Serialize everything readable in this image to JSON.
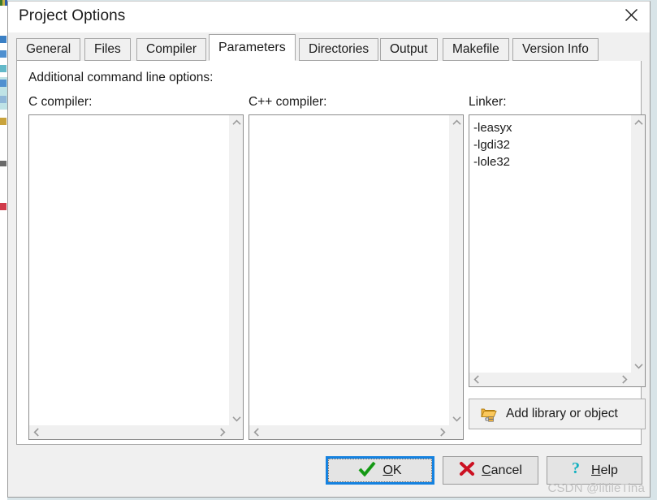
{
  "window": {
    "title": "Project Options",
    "close_label": "×"
  },
  "tabs": [
    {
      "label": "General",
      "active": false
    },
    {
      "label": "Files",
      "active": false
    },
    {
      "label": "Compiler",
      "active": false
    },
    {
      "label": "Parameters",
      "active": true
    },
    {
      "label": "Directories",
      "active": false
    },
    {
      "label": "Output",
      "active": false
    },
    {
      "label": "Makefile",
      "active": false
    },
    {
      "label": "Version Info",
      "active": false
    }
  ],
  "page": {
    "section_label": "Additional command line options:",
    "columns": [
      {
        "label": "C compiler:",
        "value": ""
      },
      {
        "label": "C++ compiler:",
        "value": ""
      },
      {
        "label": "Linker:",
        "value": "-leasyx\n-lgdi32\n-lole32"
      }
    ],
    "add_library_button": "Add library or object"
  },
  "buttons": {
    "ok": {
      "label": "OK",
      "accel": "O",
      "icon": "check-icon",
      "default": true
    },
    "cancel": {
      "label": "Cancel",
      "accel": "C",
      "icon": "cross-icon",
      "default": false
    },
    "help": {
      "label": "Help",
      "accel": "H",
      "icon": "question-icon",
      "default": false
    }
  },
  "watermark": "CSDN @litileTina",
  "colors": {
    "accent": "#1582e0",
    "ok_check": "#18a018",
    "cancel_cross": "#cc1122",
    "help_question": "#12b0c0",
    "folder": "#f0a81e",
    "dialog_face": "#f0f0f0",
    "page_face": "#ffffff"
  }
}
